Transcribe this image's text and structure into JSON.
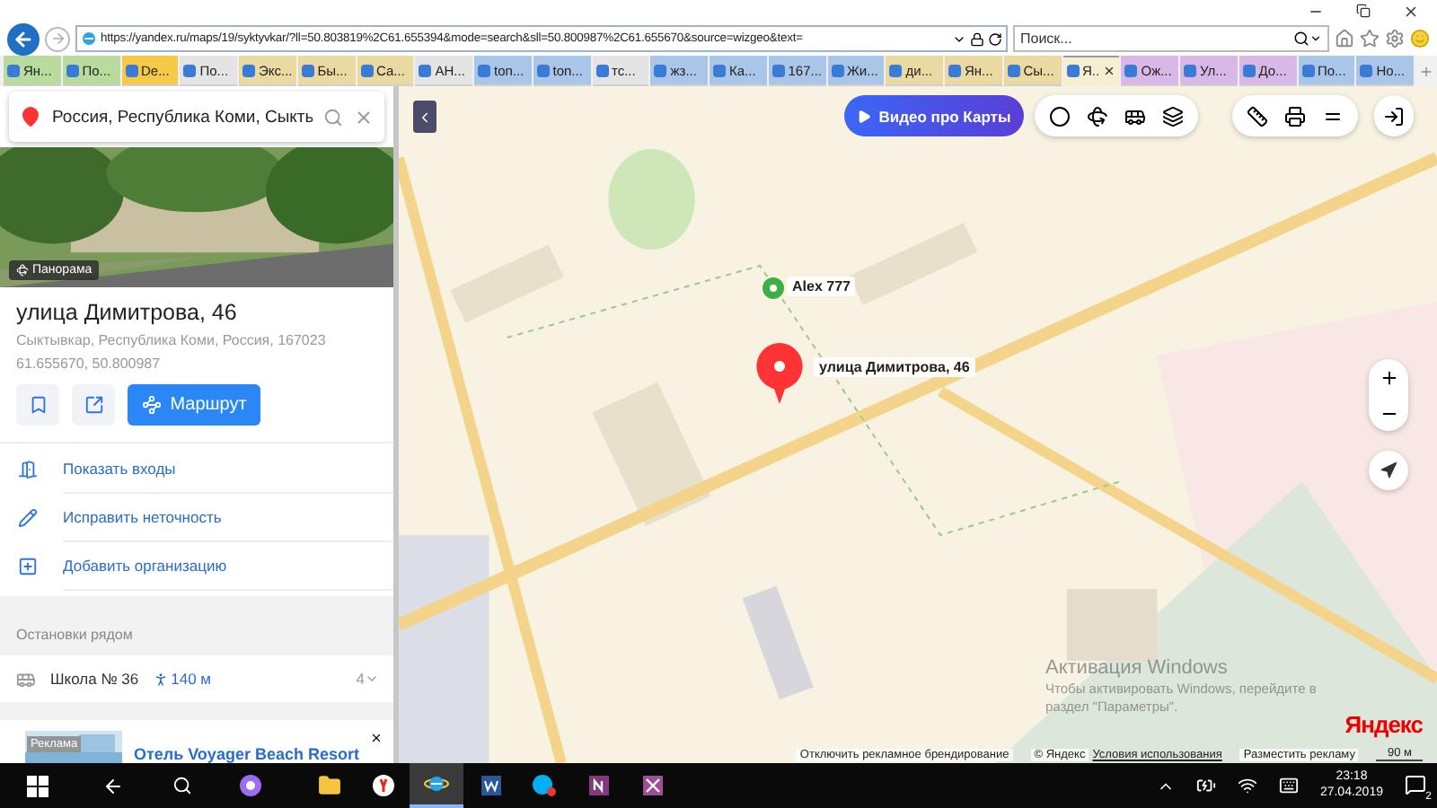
{
  "address_bar": {
    "url": "https://yandex.ru/maps/19/syktyvkar/?ll=50.803819%2C61.655394&mode=search&sll=50.800987%2C61.655670&source=wizgeo&text="
  },
  "search_box": {
    "placeholder": "Поиск..."
  },
  "tabs": [
    {
      "label": "Ян...",
      "selected": false,
      "color": "#b9dc9e"
    },
    {
      "label": "По...",
      "selected": false,
      "color": "#b9dc9e"
    },
    {
      "label": "De...",
      "selected": false,
      "color": "#f7c948"
    },
    {
      "label": "По...",
      "selected": false,
      "color": "#e4e4e4"
    },
    {
      "label": "Экс...",
      "selected": false,
      "color": "#ead9a0"
    },
    {
      "label": "Бы...",
      "selected": false,
      "color": "#ead9a0"
    },
    {
      "label": "Са...",
      "selected": false,
      "color": "#ead9a0"
    },
    {
      "label": "АН...",
      "selected": false,
      "color": "#e4e4e4"
    },
    {
      "label": "ton...",
      "selected": false,
      "color": "#a9c6e8"
    },
    {
      "label": "ton...",
      "selected": false,
      "color": "#a9c6e8"
    },
    {
      "label": "тс...",
      "selected": false,
      "color": "#e4e4e4"
    },
    {
      "label": "жз...",
      "selected": false,
      "color": "#a9c6e8"
    },
    {
      "label": "Ка...",
      "selected": false,
      "color": "#a9c6e8"
    },
    {
      "label": "167...",
      "selected": false,
      "color": "#a9c6e8"
    },
    {
      "label": "Жи...",
      "selected": false,
      "color": "#a9c6e8"
    },
    {
      "label": "ди...",
      "selected": false,
      "color": "#ead9a0"
    },
    {
      "label": "Ян...",
      "selected": false,
      "color": "#ead9a0"
    },
    {
      "label": "Сы...",
      "selected": false,
      "color": "#ead9a0"
    },
    {
      "label": "Я..",
      "selected": true,
      "color": "#f6eed0"
    },
    {
      "label": "Ож...",
      "selected": false,
      "color": "#d7b8e6"
    },
    {
      "label": "Ул...",
      "selected": false,
      "color": "#d7b8e6"
    },
    {
      "label": "До...",
      "selected": false,
      "color": "#d7b8e6"
    },
    {
      "label": "По...",
      "selected": false,
      "color": "#a9c6e8"
    },
    {
      "label": "Но...",
      "selected": false,
      "color": "#a9c6e8"
    }
  ],
  "place_search": {
    "value": "Россия, Республика Коми, Сыкть"
  },
  "place": {
    "photo_badge": "Панорама",
    "title": "улица Димитрова, 46",
    "address": "Сыктывкар, Республика Коми, Россия, 167023",
    "coordinates": "61.655670, 50.800987",
    "route_button": "Маршрут"
  },
  "actions": [
    {
      "kind": "entrances",
      "label": "Показать входы"
    },
    {
      "kind": "edit",
      "label": "Исправить неточность"
    },
    {
      "kind": "add",
      "label": "Добавить организацию"
    }
  ],
  "stops": {
    "heading": "Остановки рядом",
    "items": [
      {
        "name": "Школа № 36",
        "distance": "140 м",
        "count": "4"
      }
    ]
  },
  "ad": {
    "badge": "Реклама",
    "title": "Отель Voyager Beach Resort"
  },
  "map": {
    "video_button": "Видео про Карты",
    "markers": [
      {
        "kind": "user",
        "label": "Alex 777"
      },
      {
        "kind": "place",
        "label": "улица Димитрова, 46"
      }
    ],
    "logo": "Яндекс",
    "footer": {
      "disable_branding": "Отключить рекламное брендирование",
      "copyright": "© Яндекс",
      "terms": "Условия использования",
      "advertise": "Разместить рекламу",
      "scale": "90 м"
    }
  },
  "activation": {
    "title": "Активация Windows",
    "lines": [
      "Чтобы активировать Windows, перейдите в",
      "раздел \"Параметры\"."
    ]
  },
  "taskbar": {
    "apps": [
      {
        "kind": "explorer",
        "selected": false
      },
      {
        "kind": "yandex",
        "selected": false
      },
      {
        "kind": "ie",
        "selected": true
      },
      {
        "kind": "word",
        "selected": false
      },
      {
        "kind": "skype",
        "selected": false
      },
      {
        "kind": "onenote",
        "selected": false
      },
      {
        "kind": "onenote2",
        "selected": false
      }
    ],
    "time": "23:18",
    "date": "27.04.2019",
    "notifications": "2"
  }
}
